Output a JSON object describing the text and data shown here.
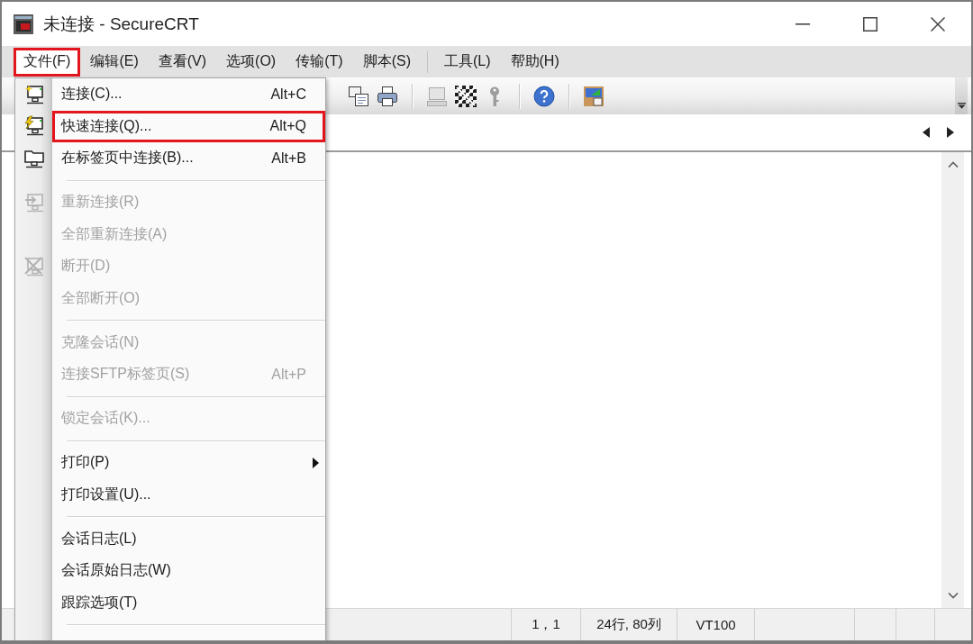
{
  "window": {
    "title": "未连接 - SecureCRT"
  },
  "menu_bar": {
    "groups": [
      [
        {
          "label": "文件(F)",
          "selected": true,
          "highlighted": true
        },
        {
          "label": "编辑(E)",
          "selected": false,
          "highlighted": false
        },
        {
          "label": "查看(V)",
          "selected": false,
          "highlighted": false
        },
        {
          "label": "选项(O)",
          "selected": false,
          "highlighted": false
        },
        {
          "label": "传输(T)",
          "selected": false,
          "highlighted": false
        },
        {
          "label": "脚本(S)",
          "selected": false,
          "highlighted": false
        }
      ],
      [
        {
          "label": "工具(L)",
          "selected": false,
          "highlighted": false
        },
        {
          "label": "帮助(H)",
          "selected": false,
          "highlighted": false
        }
      ]
    ]
  },
  "toolbar": {
    "groups": [
      [
        {
          "disabled": false
        },
        {
          "disabled": false
        }
      ],
      [
        {
          "disabled": true
        },
        {
          "disabled": false
        },
        {
          "disabled": true
        }
      ],
      [
        {
          "disabled": false
        }
      ],
      [
        {
          "disabled": false
        }
      ]
    ]
  },
  "file_menu": {
    "groups": [
      [
        {
          "label": "连接(C)...",
          "shortcut": "Alt+C",
          "disabled": false,
          "highlighted": false,
          "submenu": false
        },
        {
          "label": "快速连接(Q)...",
          "shortcut": "Alt+Q",
          "disabled": false,
          "highlighted": true,
          "submenu": false
        },
        {
          "label": "在标签页中连接(B)...",
          "shortcut": "Alt+B",
          "disabled": false,
          "highlighted": false,
          "submenu": false
        }
      ],
      [
        {
          "label": "重新连接(R)",
          "disabled": true,
          "highlighted": false,
          "submenu": false
        },
        {
          "label": "全部重新连接(A)",
          "disabled": true,
          "highlighted": false,
          "submenu": false
        },
        {
          "label": "断开(D)",
          "disabled": true,
          "highlighted": false,
          "submenu": false
        },
        {
          "label": "全部断开(O)",
          "disabled": true,
          "highlighted": false,
          "submenu": false
        }
      ],
      [
        {
          "label": "克隆会话(N)",
          "disabled": true,
          "highlighted": false,
          "submenu": false
        },
        {
          "label": "连接SFTP标签页(S)",
          "shortcut": "Alt+P",
          "disabled": true,
          "highlighted": false,
          "submenu": false
        }
      ],
      [
        {
          "label": "锁定会话(K)...",
          "disabled": true,
          "highlighted": false,
          "submenu": false
        }
      ],
      [
        {
          "label": "打印(P)",
          "disabled": false,
          "highlighted": false,
          "submenu": true
        },
        {
          "label": "打印设置(U)...",
          "disabled": false,
          "highlighted": false,
          "submenu": false
        }
      ],
      [
        {
          "label": "会话日志(L)",
          "disabled": false,
          "highlighted": false,
          "submenu": false
        },
        {
          "label": "会话原始日志(W)",
          "disabled": false,
          "highlighted": false,
          "submenu": false
        },
        {
          "label": "跟踪选项(T)",
          "disabled": false,
          "highlighted": false,
          "submenu": false
        }
      ]
    ]
  },
  "status_bar": {
    "panes": [
      "1，1",
      "24行, 80列",
      "VT100"
    ]
  }
}
